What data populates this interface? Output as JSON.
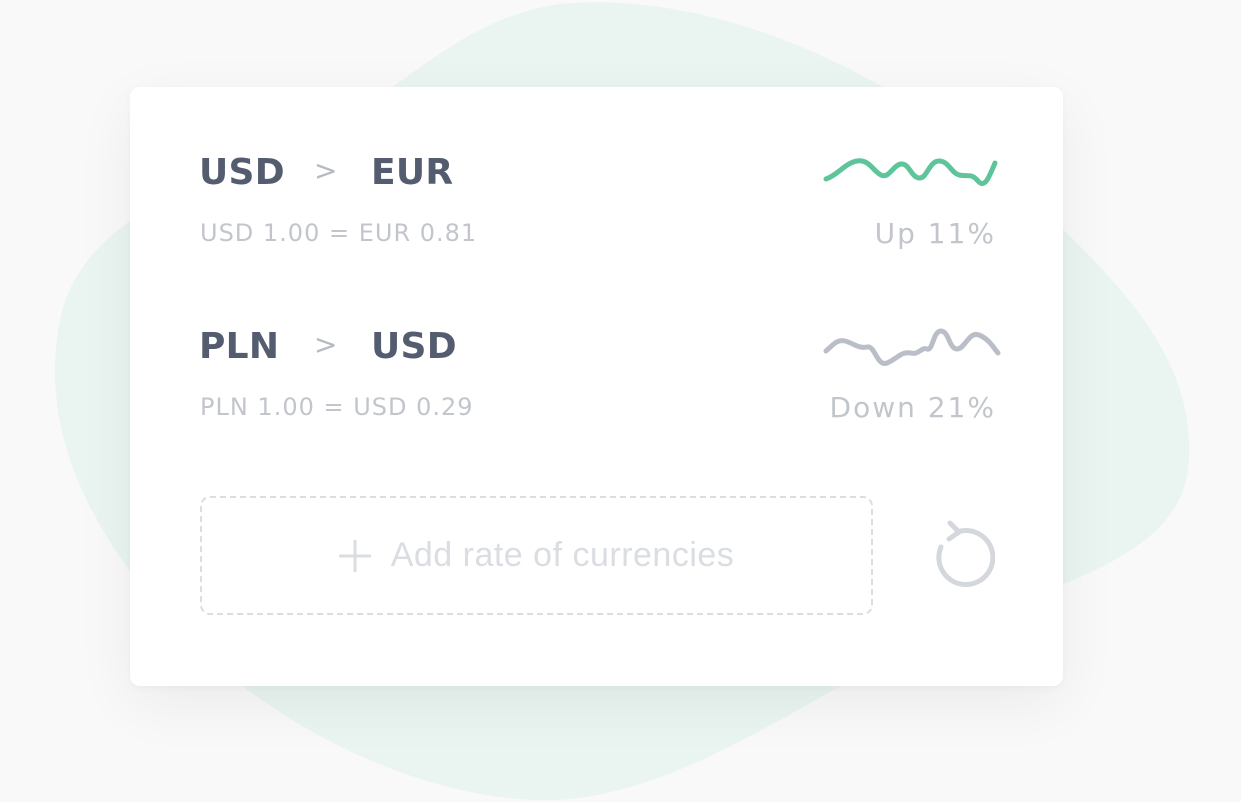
{
  "colors": {
    "pair_text": "#545c6f",
    "muted_text": "#c2c6cc",
    "accent_green": "#5ec49a",
    "line_grey": "#babec6",
    "dashed_border": "#dadde1",
    "blob": "#e9f5f2"
  },
  "rows": [
    {
      "from": "USD",
      "separator": ">",
      "to": "EUR",
      "rate": "USD 1.00 = EUR 0.81",
      "change": "Up 11%",
      "trend": "up"
    },
    {
      "from": "PLN",
      "separator": ">",
      "to": "USD",
      "rate": "PLN 1.00 = USD 0.29",
      "change": "Down 21%",
      "trend": "down"
    }
  ],
  "add_button": {
    "icon": "plus-icon",
    "label": "Add rate of currencies"
  },
  "refresh_button": {
    "icon": "refresh-icon"
  }
}
